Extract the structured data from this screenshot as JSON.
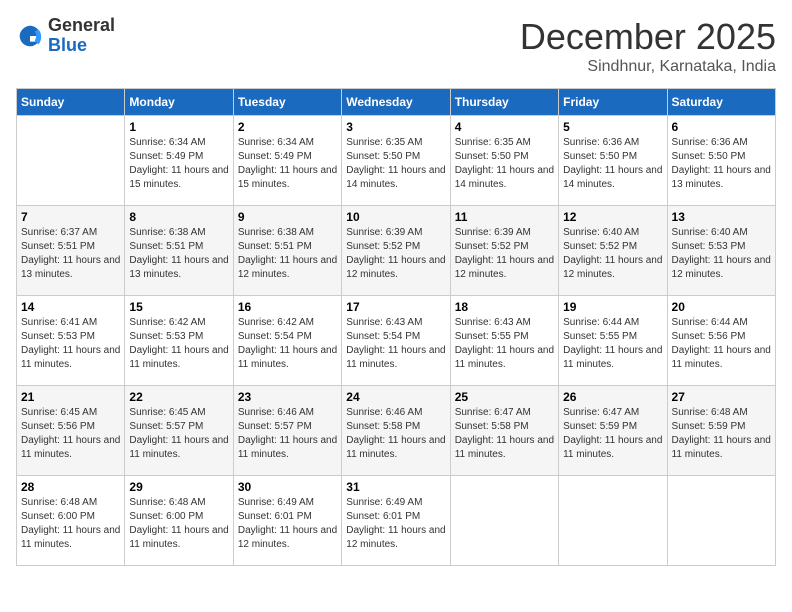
{
  "logo": {
    "general": "General",
    "blue": "Blue"
  },
  "header": {
    "month": "December 2025",
    "location": "Sindhnur, Karnataka, India"
  },
  "weekdays": [
    "Sunday",
    "Monday",
    "Tuesday",
    "Wednesday",
    "Thursday",
    "Friday",
    "Saturday"
  ],
  "weeks": [
    [
      {
        "day": "",
        "sunrise": "",
        "sunset": "",
        "daylight": ""
      },
      {
        "day": "1",
        "sunrise": "6:34 AM",
        "sunset": "5:49 PM",
        "daylight": "11 hours and 15 minutes."
      },
      {
        "day": "2",
        "sunrise": "6:34 AM",
        "sunset": "5:49 PM",
        "daylight": "11 hours and 15 minutes."
      },
      {
        "day": "3",
        "sunrise": "6:35 AM",
        "sunset": "5:50 PM",
        "daylight": "11 hours and 14 minutes."
      },
      {
        "day": "4",
        "sunrise": "6:35 AM",
        "sunset": "5:50 PM",
        "daylight": "11 hours and 14 minutes."
      },
      {
        "day": "5",
        "sunrise": "6:36 AM",
        "sunset": "5:50 PM",
        "daylight": "11 hours and 14 minutes."
      },
      {
        "day": "6",
        "sunrise": "6:36 AM",
        "sunset": "5:50 PM",
        "daylight": "11 hours and 13 minutes."
      }
    ],
    [
      {
        "day": "7",
        "sunrise": "6:37 AM",
        "sunset": "5:51 PM",
        "daylight": "11 hours and 13 minutes."
      },
      {
        "day": "8",
        "sunrise": "6:38 AM",
        "sunset": "5:51 PM",
        "daylight": "11 hours and 13 minutes."
      },
      {
        "day": "9",
        "sunrise": "6:38 AM",
        "sunset": "5:51 PM",
        "daylight": "11 hours and 12 minutes."
      },
      {
        "day": "10",
        "sunrise": "6:39 AM",
        "sunset": "5:52 PM",
        "daylight": "11 hours and 12 minutes."
      },
      {
        "day": "11",
        "sunrise": "6:39 AM",
        "sunset": "5:52 PM",
        "daylight": "11 hours and 12 minutes."
      },
      {
        "day": "12",
        "sunrise": "6:40 AM",
        "sunset": "5:52 PM",
        "daylight": "11 hours and 12 minutes."
      },
      {
        "day": "13",
        "sunrise": "6:40 AM",
        "sunset": "5:53 PM",
        "daylight": "11 hours and 12 minutes."
      }
    ],
    [
      {
        "day": "14",
        "sunrise": "6:41 AM",
        "sunset": "5:53 PM",
        "daylight": "11 hours and 11 minutes."
      },
      {
        "day": "15",
        "sunrise": "6:42 AM",
        "sunset": "5:53 PM",
        "daylight": "11 hours and 11 minutes."
      },
      {
        "day": "16",
        "sunrise": "6:42 AM",
        "sunset": "5:54 PM",
        "daylight": "11 hours and 11 minutes."
      },
      {
        "day": "17",
        "sunrise": "6:43 AM",
        "sunset": "5:54 PM",
        "daylight": "11 hours and 11 minutes."
      },
      {
        "day": "18",
        "sunrise": "6:43 AM",
        "sunset": "5:55 PM",
        "daylight": "11 hours and 11 minutes."
      },
      {
        "day": "19",
        "sunrise": "6:44 AM",
        "sunset": "5:55 PM",
        "daylight": "11 hours and 11 minutes."
      },
      {
        "day": "20",
        "sunrise": "6:44 AM",
        "sunset": "5:56 PM",
        "daylight": "11 hours and 11 minutes."
      }
    ],
    [
      {
        "day": "21",
        "sunrise": "6:45 AM",
        "sunset": "5:56 PM",
        "daylight": "11 hours and 11 minutes."
      },
      {
        "day": "22",
        "sunrise": "6:45 AM",
        "sunset": "5:57 PM",
        "daylight": "11 hours and 11 minutes."
      },
      {
        "day": "23",
        "sunrise": "6:46 AM",
        "sunset": "5:57 PM",
        "daylight": "11 hours and 11 minutes."
      },
      {
        "day": "24",
        "sunrise": "6:46 AM",
        "sunset": "5:58 PM",
        "daylight": "11 hours and 11 minutes."
      },
      {
        "day": "25",
        "sunrise": "6:47 AM",
        "sunset": "5:58 PM",
        "daylight": "11 hours and 11 minutes."
      },
      {
        "day": "26",
        "sunrise": "6:47 AM",
        "sunset": "5:59 PM",
        "daylight": "11 hours and 11 minutes."
      },
      {
        "day": "27",
        "sunrise": "6:48 AM",
        "sunset": "5:59 PM",
        "daylight": "11 hours and 11 minutes."
      }
    ],
    [
      {
        "day": "28",
        "sunrise": "6:48 AM",
        "sunset": "6:00 PM",
        "daylight": "11 hours and 11 minutes."
      },
      {
        "day": "29",
        "sunrise": "6:48 AM",
        "sunset": "6:00 PM",
        "daylight": "11 hours and 11 minutes."
      },
      {
        "day": "30",
        "sunrise": "6:49 AM",
        "sunset": "6:01 PM",
        "daylight": "11 hours and 12 minutes."
      },
      {
        "day": "31",
        "sunrise": "6:49 AM",
        "sunset": "6:01 PM",
        "daylight": "11 hours and 12 minutes."
      },
      {
        "day": "",
        "sunrise": "",
        "sunset": "",
        "daylight": ""
      },
      {
        "day": "",
        "sunrise": "",
        "sunset": "",
        "daylight": ""
      },
      {
        "day": "",
        "sunrise": "",
        "sunset": "",
        "daylight": ""
      }
    ]
  ]
}
